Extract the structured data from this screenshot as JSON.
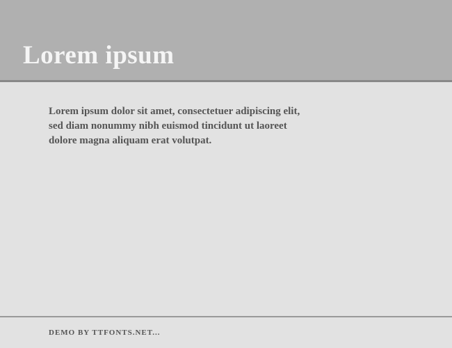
{
  "header": {
    "title": "Lorem ipsum"
  },
  "content": {
    "body": "Lorem ipsum dolor sit amet, consectetuer adipiscing elit, sed diam nonummy nibh euismod tincidunt ut laoreet dolore magna aliquam erat volutpat."
  },
  "footer": {
    "credit": "DEMO BY TTFONTS.NET..."
  }
}
